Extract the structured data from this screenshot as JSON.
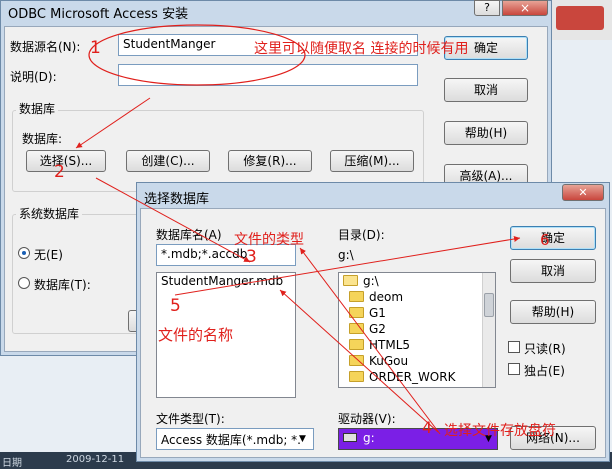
{
  "odbc": {
    "title": "ODBC Microsoft Access 安装",
    "help_glyph": "?",
    "close_glyph": "×",
    "dsn_label": "数据源名(N):",
    "dsn_value": "StudentManger",
    "desc_label": "说明(D):",
    "desc_value": "",
    "db_group": "数据库",
    "db_label": "数据库:",
    "select": "选择(S)...",
    "create": "创建(C)...",
    "repair": "修复(R)...",
    "compact": "压缩(M)...",
    "ok": "确定",
    "cancel": "取消",
    "help": "帮助(H)",
    "advanced": "高级(A)...",
    "sysdb_group": "系统数据库",
    "none": "无(E)",
    "database": "数据库(T):"
  },
  "select_db": {
    "title": "选择数据库",
    "close_glyph": "✕",
    "dbname_label": "数据库名(A)",
    "dbname_value": "*.mdb;*.accdb",
    "files": [
      "StudentManger.mdb"
    ],
    "dir_label": "目录(D):",
    "dir_value": "g:\\",
    "dirs": [
      {
        "name": "g:\\",
        "open": true
      },
      {
        "name": "deom",
        "open": false
      },
      {
        "name": "G1",
        "open": false
      },
      {
        "name": "G2",
        "open": false
      },
      {
        "name": "HTML5",
        "open": false
      },
      {
        "name": "KuGou",
        "open": false
      },
      {
        "name": "ORDER_WORK",
        "open": false
      }
    ],
    "ok": "确定",
    "cancel": "取消",
    "help": "帮助(H)",
    "readonly": "只读(R)",
    "exclusive": "独占(E)",
    "filetype_label": "文件类型(T):",
    "filetype_value": "Access 数据库(*.mdb; *.",
    "drives_label": "驱动器(V):",
    "drive_value": "g:",
    "network": "网络(N)..."
  },
  "annotations": {
    "n1": "1",
    "note1": "这里可以随便取名 连接的时候有用",
    "n2": "2",
    "n3": "3",
    "note3": "文件的类型",
    "n4": "4",
    "note4": "选择文件存放盘符",
    "n5": "5",
    "note5": "文件的名称",
    "n6": "6"
  },
  "background": {
    "status_left": "日期",
    "status_date": "2009-12-11"
  },
  "colors": {
    "annotation": "#e0201c",
    "drive_highlight": "#7b1fe6",
    "title_frame": "#c9d9ea",
    "close_button": "#c9463d"
  }
}
